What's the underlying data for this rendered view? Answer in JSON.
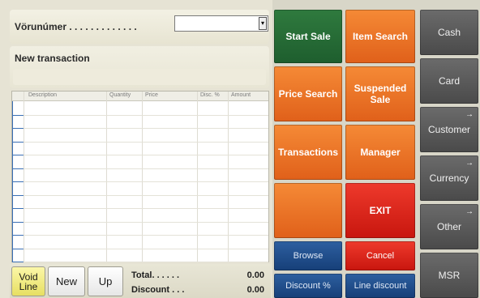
{
  "product": {
    "label": "Vörunúmer . . . . . . . . . . . . .",
    "value": "",
    "dropdown_glyph": "▾"
  },
  "transaction": {
    "title": "New transaction",
    "subtitle": ""
  },
  "grid": {
    "headers": [
      "Description",
      "Quantity",
      "Price",
      "Disc. %",
      "Amount"
    ],
    "rows": []
  },
  "bottom": {
    "void_line": "Void Line",
    "new": "New",
    "up": "Up",
    "total_label": "Total. . . . . .",
    "total_value": "0.00",
    "discount_label": "Discount . . .",
    "discount_value": "0.00"
  },
  "buttons": {
    "start_sale": "Start Sale",
    "item_search": "Item Search",
    "price_search": "Price Search",
    "suspended_sale": "Suspended Sale",
    "transactions": "Transactions",
    "manager": "Manager",
    "blank": "",
    "exit": "EXIT",
    "browse": "Browse",
    "cancel": "Cancel",
    "discount_pct": "Discount %",
    "line_discount": "Line discount"
  },
  "payment": {
    "cash": "Cash",
    "card": "Card",
    "customer": "Customer",
    "currency": "Currency",
    "other": "Other",
    "msr": "MSR",
    "submenu_arrow": "→"
  },
  "colors": {
    "green": "#2f7a3e",
    "orange": "#f07a28",
    "red": "#e02a1c",
    "blue": "#1f4d8a",
    "gray": "#5a5a5a",
    "void_yellow": "#f3ec86"
  }
}
